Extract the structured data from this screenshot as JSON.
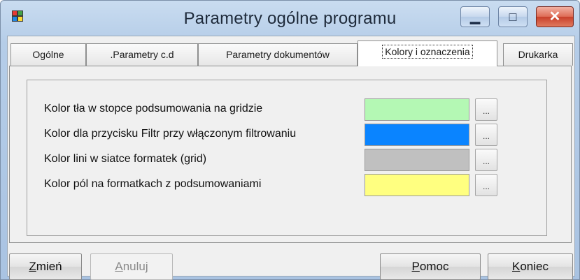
{
  "window": {
    "title": "Parametry ogólne programu",
    "controls": {
      "minimize": "▁",
      "maximize": "□",
      "close": "✕"
    }
  },
  "tabs": [
    {
      "label": "Ogólne"
    },
    {
      "label": ".Parametry c.d"
    },
    {
      "label": "Parametry dokumentów"
    },
    {
      "label": "Kolory i oznaczenia",
      "active": true
    },
    {
      "label": "Drukarka"
    }
  ],
  "color_settings": [
    {
      "label": "Kolor tła w stopce podsumowania na gridzie",
      "color": "#b4f8b4",
      "button": "..."
    },
    {
      "label": "Kolor dla przycisku Filtr przy włączonym filtrowaniu",
      "color": "#0a84ff",
      "button": "..."
    },
    {
      "label": "Kolor lini w siatce formatek (grid)",
      "color": "#c0c0c0",
      "button": "..."
    },
    {
      "label": "Kolor pól na formatkach z podsumowaniami",
      "color": "#ffff80",
      "button": "..."
    }
  ],
  "buttons": {
    "zmien": {
      "first": "Z",
      "rest": "mień"
    },
    "anuluj": {
      "first": "A",
      "rest": "nuluj"
    },
    "pomoc": {
      "first": "P",
      "rest": "omoc"
    },
    "koniec": {
      "first": "K",
      "rest": "oniec"
    }
  }
}
